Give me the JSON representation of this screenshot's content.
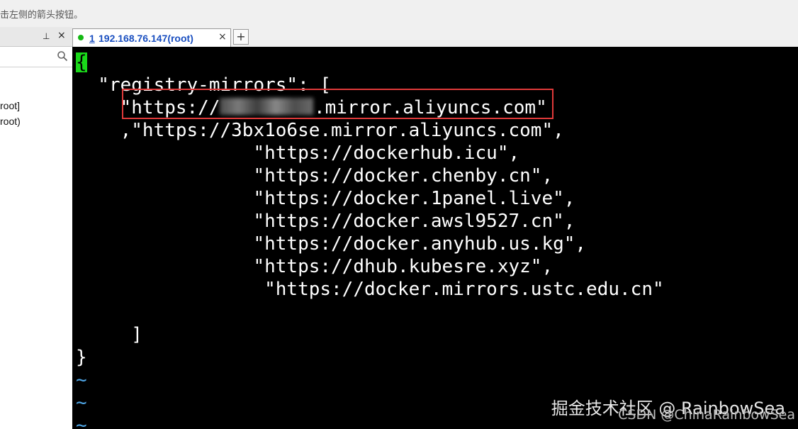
{
  "top_hint": "击左侧的箭头按钮。",
  "left_panel": {
    "sessions": [
      "root]",
      "root)"
    ]
  },
  "tab": {
    "index": "1",
    "label": "192.168.76.147(root)",
    "close": "×"
  },
  "new_tab": "+",
  "lp": {
    "pin": "⊥",
    "close": "×"
  },
  "terminal": {
    "cursor_char": "{",
    "lines": [
      "  \"registry-mirrors\": [",
      "    \"https://",
      ".mirror.aliyuncs.com\"",
      "    ,\"https://3bx1o6se.mirror.aliyuncs.com\",",
      "                \"https://dockerhub.icu\",",
      "                \"https://docker.chenby.cn\",",
      "                \"https://docker.1panel.live\",",
      "                \"https://docker.awsl9527.cn\",",
      "                \"https://docker.anyhub.us.kg\",",
      "                \"https://dhub.kubesre.xyz\",",
      "                 \"https://docker.mirrors.ustc.edu.cn\"",
      "     ]",
      "}"
    ],
    "tilde": "~"
  },
  "watermark": {
    "line1": "掘金技术社区 @ RainbowSea",
    "line2": "CSDN @ChinaRainbowSea"
  },
  "colors": {
    "cursor": "#1ad81a",
    "highlight_box": "#e03a3a",
    "tab_text": "#1a4fc0",
    "tilde": "#4fa6e6"
  }
}
